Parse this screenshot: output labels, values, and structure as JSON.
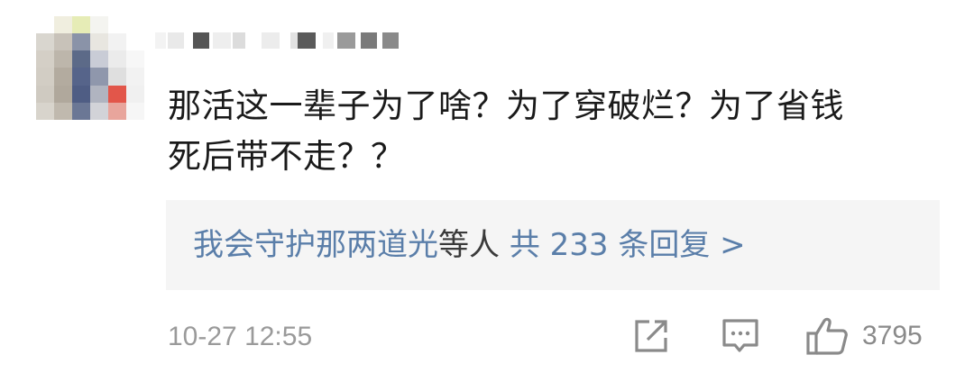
{
  "comment": {
    "text_line1": "那活这一辈子为了啥？为了穿破烂？为了省钱",
    "text_line2": "死后带不走？？",
    "replies": {
      "users": "我会守护那两道光",
      "others": "等人",
      "count_label": "共 233 条回复 >"
    },
    "timestamp": "10-27 12:55",
    "like_count": "3795"
  },
  "icons": {
    "share": "share-icon",
    "reply": "comment-icon",
    "like": "thumbs-up-icon"
  },
  "colors": {
    "link": "#5a7ea9",
    "muted": "#9a9a9a"
  }
}
